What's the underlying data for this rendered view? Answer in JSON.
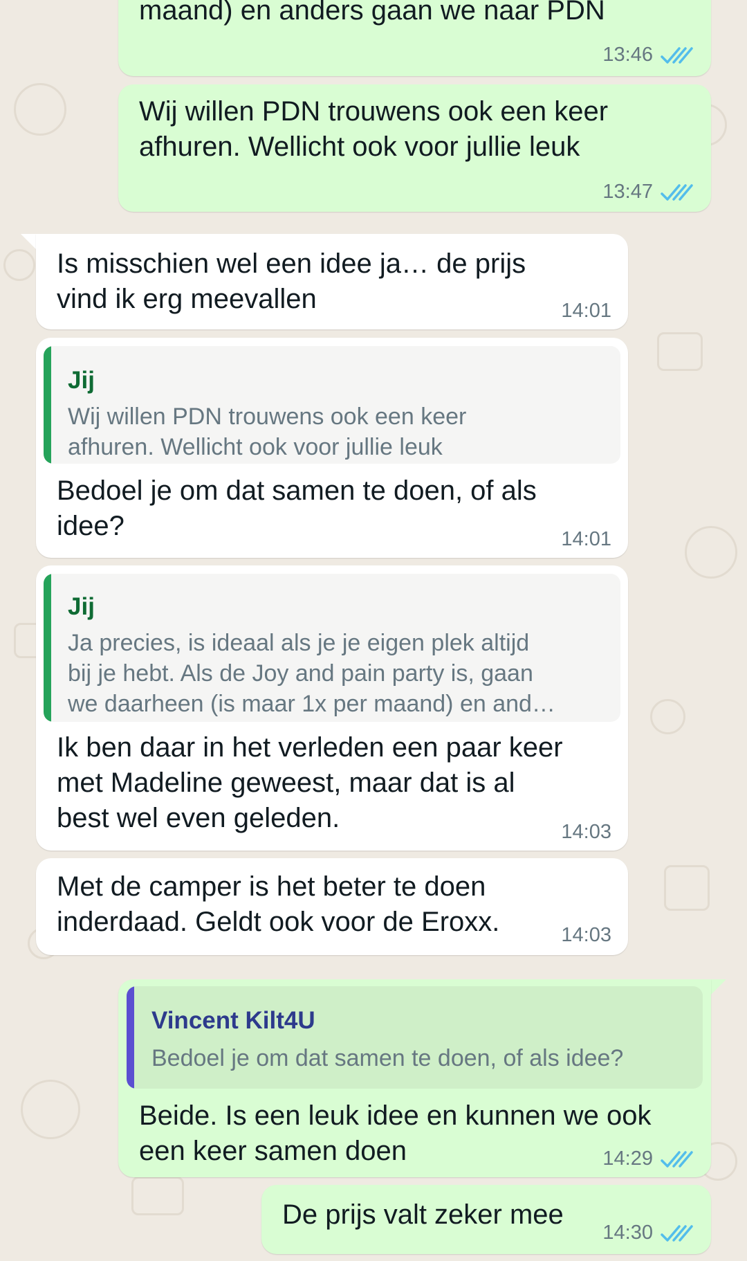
{
  "colors": {
    "outgoing_bubble": "#d9fdd3",
    "incoming_bubble": "#ffffff",
    "read_ticks": "#53bdeb",
    "quote_bar_self": "#25a35a",
    "quote_bar_other": "#5b4fd1",
    "background": "#efeae2"
  },
  "messages": [
    {
      "direction": "outgoing",
      "text": "maand) en anders gaan we naar PDN",
      "time": "13:46",
      "status_icon": "double-check-read-icon"
    },
    {
      "direction": "outgoing",
      "text": "Wij willen PDN trouwens ook een keer\nafhuren. Wellicht ook voor jullie leuk",
      "time": "13:47",
      "status_icon": "double-check-read-icon"
    },
    {
      "direction": "incoming",
      "text": "Is misschien wel een idee ja… de prijs\nvind ik erg meevallen",
      "time": "14:01"
    },
    {
      "direction": "incoming",
      "quote": {
        "author": "Jij",
        "text": "Wij willen PDN trouwens ook een keer\nafhuren. Wellicht ook voor jullie leuk"
      },
      "text": "Bedoel je om dat samen te doen, of als\nidee?",
      "time": "14:01"
    },
    {
      "direction": "incoming",
      "quote": {
        "author": "Jij",
        "text": "Ja precies, is ideaal als je je eigen plek altijd\nbij je hebt. Als de Joy and pain party is, gaan\nwe daarheen (is maar 1x per maand) en and…"
      },
      "text": "Ik ben daar in het verleden een paar keer\nmet Madeline geweest, maar dat is al\nbest wel even geleden.",
      "time": "14:03"
    },
    {
      "direction": "incoming",
      "text": "Met de camper is het beter te doen\ninderdaad. Geldt ook voor de Eroxx.",
      "time": "14:03"
    },
    {
      "direction": "outgoing",
      "quote": {
        "author": "Vincent Kilt4U",
        "text": "Bedoel je om dat samen te doen, of als idee?"
      },
      "text": "Beide. Is een leuk idee en kunnen we ook\neen keer samen doen",
      "time": "14:29",
      "status_icon": "double-check-read-icon"
    },
    {
      "direction": "outgoing",
      "text": "De prijs valt zeker mee",
      "time": "14:30",
      "status_icon": "double-check-read-icon"
    }
  ]
}
